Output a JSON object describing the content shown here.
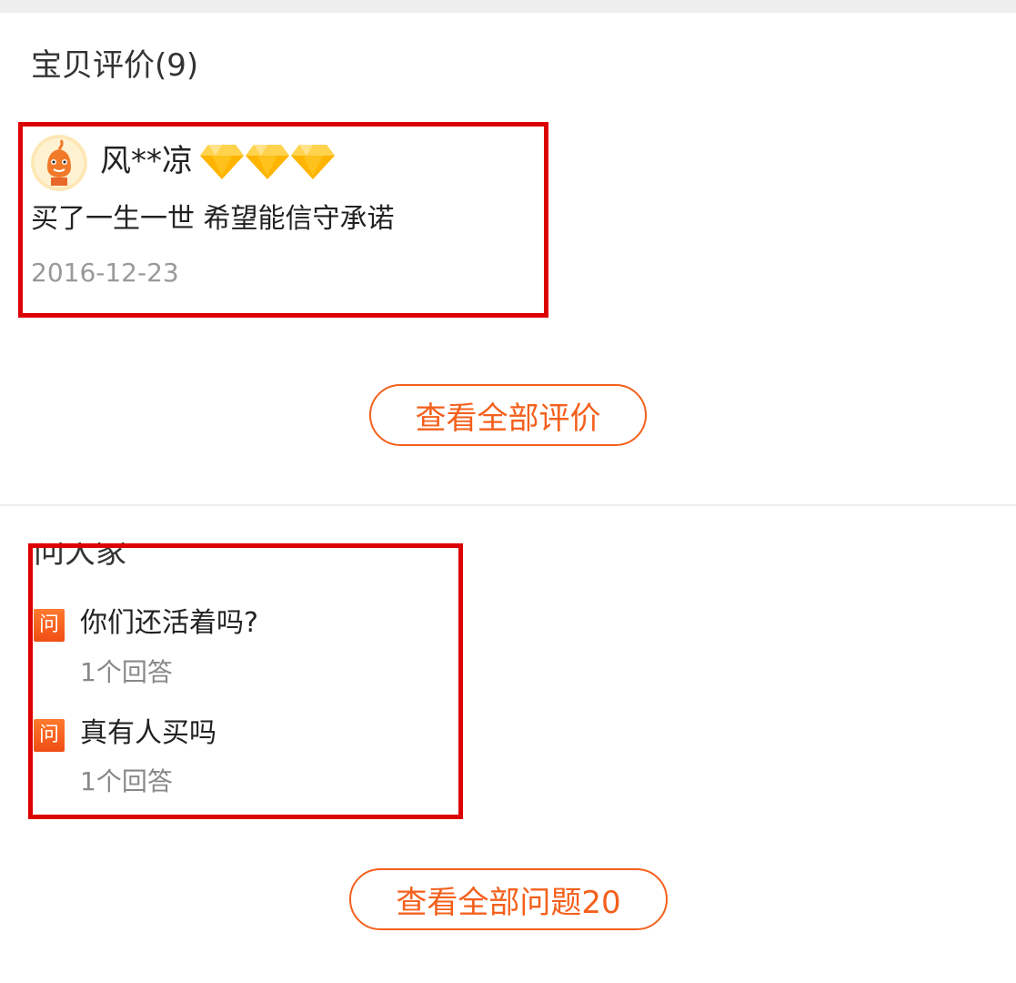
{
  "reviews": {
    "title": "宝贝评价(9)",
    "items": [
      {
        "reviewer": "风**凉",
        "rating_icons": [
          "diamond-icon",
          "diamond-icon",
          "diamond-icon"
        ],
        "content": "买了一生一世 希望能信守承诺",
        "date": "2016-12-23"
      }
    ],
    "view_all_label": "查看全部评价"
  },
  "questions": {
    "title": "问大家",
    "badge_label": "问",
    "items": [
      {
        "question": "你们还活着吗?",
        "answers": "1个回答"
      },
      {
        "question": "真有人买吗",
        "answers": "1个回答"
      }
    ],
    "view_all_label": "查看全部问题20"
  },
  "colors": {
    "accent": "#f4601c",
    "highlight": "#dd0000",
    "diamond": "#ffb400"
  }
}
